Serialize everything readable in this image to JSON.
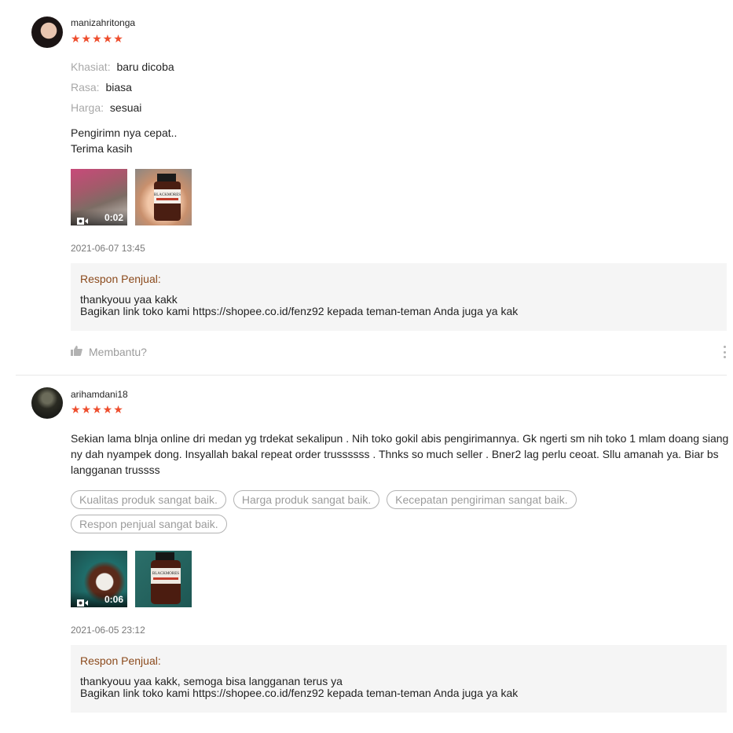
{
  "reviews": [
    {
      "username": "manizahritonga",
      "stars": "★★★★★",
      "attributes": [
        {
          "key": "Khasiat:",
          "value": "baru dicoba"
        },
        {
          "key": "Rasa:",
          "value": "biasa"
        },
        {
          "key": "Harga:",
          "value": "sesuai"
        }
      ],
      "comment": "Pengirimn nya cepat..\nTerima kasih",
      "media": [
        {
          "type": "video",
          "duration": "0:02"
        },
        {
          "type": "image",
          "product_label": "BLACKMORES"
        }
      ],
      "timestamp": "2021-06-07 13:45",
      "seller_response": {
        "label": "Respon Penjual:",
        "text": "thankyouu yaa kakk\nBagikan link toko kami https://shopee.co.id/fenz92 kepada teman-teman Anda juga ya kak"
      },
      "helpful_label": "Membantu?"
    },
    {
      "username": "arihamdani18",
      "stars": "★★★★★",
      "comment": "Sekian lama blnja online dri medan yg trdekat sekalipun . Nih toko gokil abis pengirimannya. Gk ngerti sm nih toko 1 mlam doang siang ny dah nyampek dong. Insyallah bakal repeat order trussssss . Thnks so much seller . Bner2 lag perlu ceoat. Sllu amanah ya. Biar bs langganan trussss",
      "tags": [
        "Kualitas produk sangat baik.",
        "Harga produk sangat baik.",
        "Kecepatan pengiriman sangat baik.",
        "Respon penjual sangat baik."
      ],
      "media": [
        {
          "type": "video",
          "duration": "0:06"
        },
        {
          "type": "image",
          "product_label": "BLACKMORES"
        }
      ],
      "timestamp": "2021-06-05 23:12",
      "seller_response": {
        "label": "Respon Penjual:",
        "text": "thankyouu yaa kakk, semoga bisa langganan terus ya\nBagikan link toko kami https://shopee.co.id/fenz92 kepada teman-teman Anda juga ya kak"
      }
    }
  ],
  "colors": {
    "star": "#ee4d2d",
    "seller_label": "#8b4a1c",
    "response_bg": "#f5f5f5"
  },
  "icons": [
    "star-icon",
    "video-camera-icon",
    "thumbs-up-icon",
    "more-vertical-icon"
  ]
}
